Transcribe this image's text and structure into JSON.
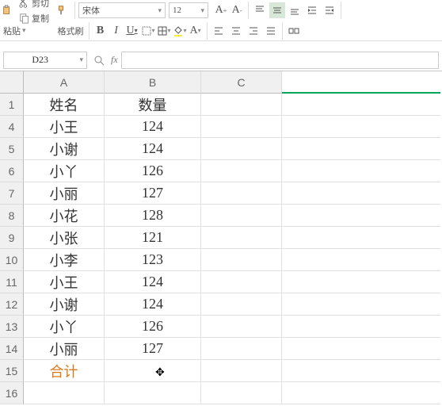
{
  "toolbar": {
    "cut": "剪切",
    "copy": "复制",
    "paste": "粘贴",
    "format": "格式刷",
    "fontname": "宋体",
    "fontsize": "12",
    "align_icons": [
      "align-top",
      "align-middle",
      "align-bottom",
      "indent-decrease",
      "indent-increase",
      "align-left",
      "align-center",
      "align-right",
      "distribute",
      "combine"
    ]
  },
  "namebox": "D23",
  "sheet": {
    "cols": [
      "A",
      "B",
      "C",
      ""
    ],
    "rows": [
      "1",
      "4",
      "5",
      "6",
      "7",
      "8",
      "9",
      "10",
      "11",
      "12",
      "13",
      "14",
      "15",
      "16"
    ],
    "data": [
      {
        "a": "姓名",
        "b": "数量"
      },
      {
        "a": "小王",
        "b": "124"
      },
      {
        "a": "小谢",
        "b": "124"
      },
      {
        "a": "小丫",
        "b": "126"
      },
      {
        "a": "小丽",
        "b": "127"
      },
      {
        "a": "小花",
        "b": "128"
      },
      {
        "a": "小张",
        "b": "121"
      },
      {
        "a": "小李",
        "b": "123"
      },
      {
        "a": "小王",
        "b": "124"
      },
      {
        "a": "小谢",
        "b": "124"
      },
      {
        "a": "小丫",
        "b": "126"
      },
      {
        "a": "小丽",
        "b": "127"
      },
      {
        "a": "合计",
        "b": "",
        "heji": true
      },
      {
        "a": "",
        "b": ""
      }
    ]
  }
}
